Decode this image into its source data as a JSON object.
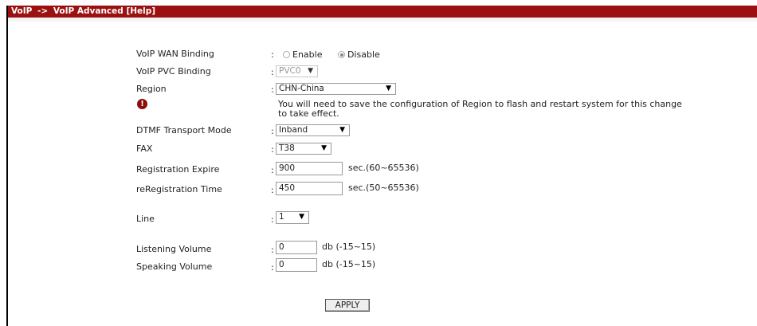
{
  "header": {
    "section": "VoIP",
    "separator": "->",
    "page": "VoIP Advanced",
    "help": "[Help]"
  },
  "form": {
    "wan_binding": {
      "label": "VoIP WAN Binding",
      "options": [
        "Enable",
        "Disable"
      ],
      "selected": "Disable"
    },
    "pvc_binding": {
      "label": "VoIP PVC Binding",
      "value": "PVC0"
    },
    "region": {
      "label": "Region",
      "value": "CHN-China",
      "note_line1": "You will need to save the configuration of Region to flash and restart system for this change",
      "note_line2": "to take effect."
    },
    "dtmf": {
      "label": "DTMF Transport Mode",
      "value": "Inband"
    },
    "fax": {
      "label": "FAX",
      "value": "T38"
    },
    "registration_expire": {
      "label": "Registration Expire",
      "value": "900",
      "unit": "sec.(60~65536)"
    },
    "reregistration_time": {
      "label": "reRegistration Time",
      "value": "450",
      "unit": "sec.(50~65536)"
    },
    "line": {
      "label": "Line",
      "value": "1"
    },
    "listening_volume": {
      "label": "Listening Volume",
      "value": "0",
      "unit": "db (-15~15)"
    },
    "speaking_volume": {
      "label": "Speaking Volume",
      "value": "0",
      "unit": "db (-15~15)"
    },
    "colon": ":",
    "apply_label": "APPLY"
  },
  "icons": {
    "warning": "exclamation-circle-icon",
    "dropdown": "triangle-down-icon",
    "radio_checked": "radio-checked-icon",
    "radio_unchecked": "radio-unchecked-icon"
  },
  "colors": {
    "title_bar": "#9b1010",
    "warning_icon": "#8b0d0d"
  }
}
